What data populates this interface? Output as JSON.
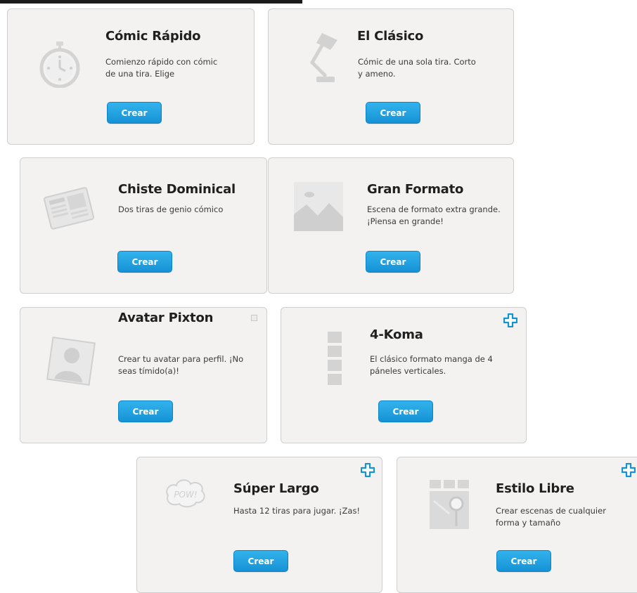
{
  "page": {
    "accent_color": "#1592d6",
    "cards": [
      {
        "title": "Cómic Rápido",
        "description": "Comienzo rápido con cómic de una tira. Elige",
        "button_label": "Crear",
        "icon": "stopwatch-icon"
      },
      {
        "title": "El Clásico",
        "description": "Cómic de una sola tira. Corto y ameno.",
        "button_label": "Crear",
        "icon": "desk-lamp-icon"
      },
      {
        "title": "Chiste Dominical",
        "description": "Dos tiras de genio cómico",
        "button_label": "Crear",
        "icon": "newspaper-icon"
      },
      {
        "title": "Gran Formato",
        "description": "Escena de formato extra grande. ¡Piensa en grande!",
        "button_label": "Crear",
        "icon": "landscape-image-icon"
      },
      {
        "title": "Avatar Pixton",
        "description": "Crear tu avatar para perfil. ¡No seas tímido(a)!",
        "button_label": "Crear",
        "icon": "avatar-silhouette-icon"
      },
      {
        "title": "4-Koma",
        "description": "El clásico formato manga de 4 páneles verticales.",
        "button_label": "Crear",
        "icon": "vertical-panels-icon"
      },
      {
        "title": "Súper Largo",
        "description": "Hasta 12 tiras para jugar. ¡Zas!",
        "button_label": "Crear",
        "icon": "pow-bubble-icon",
        "icon_text": "POW!"
      },
      {
        "title": "Estilo Libre",
        "description": "Crear escenas de cualquier forma y tamaño",
        "button_label": "Crear",
        "icon": "map-pin-icon"
      }
    ]
  }
}
